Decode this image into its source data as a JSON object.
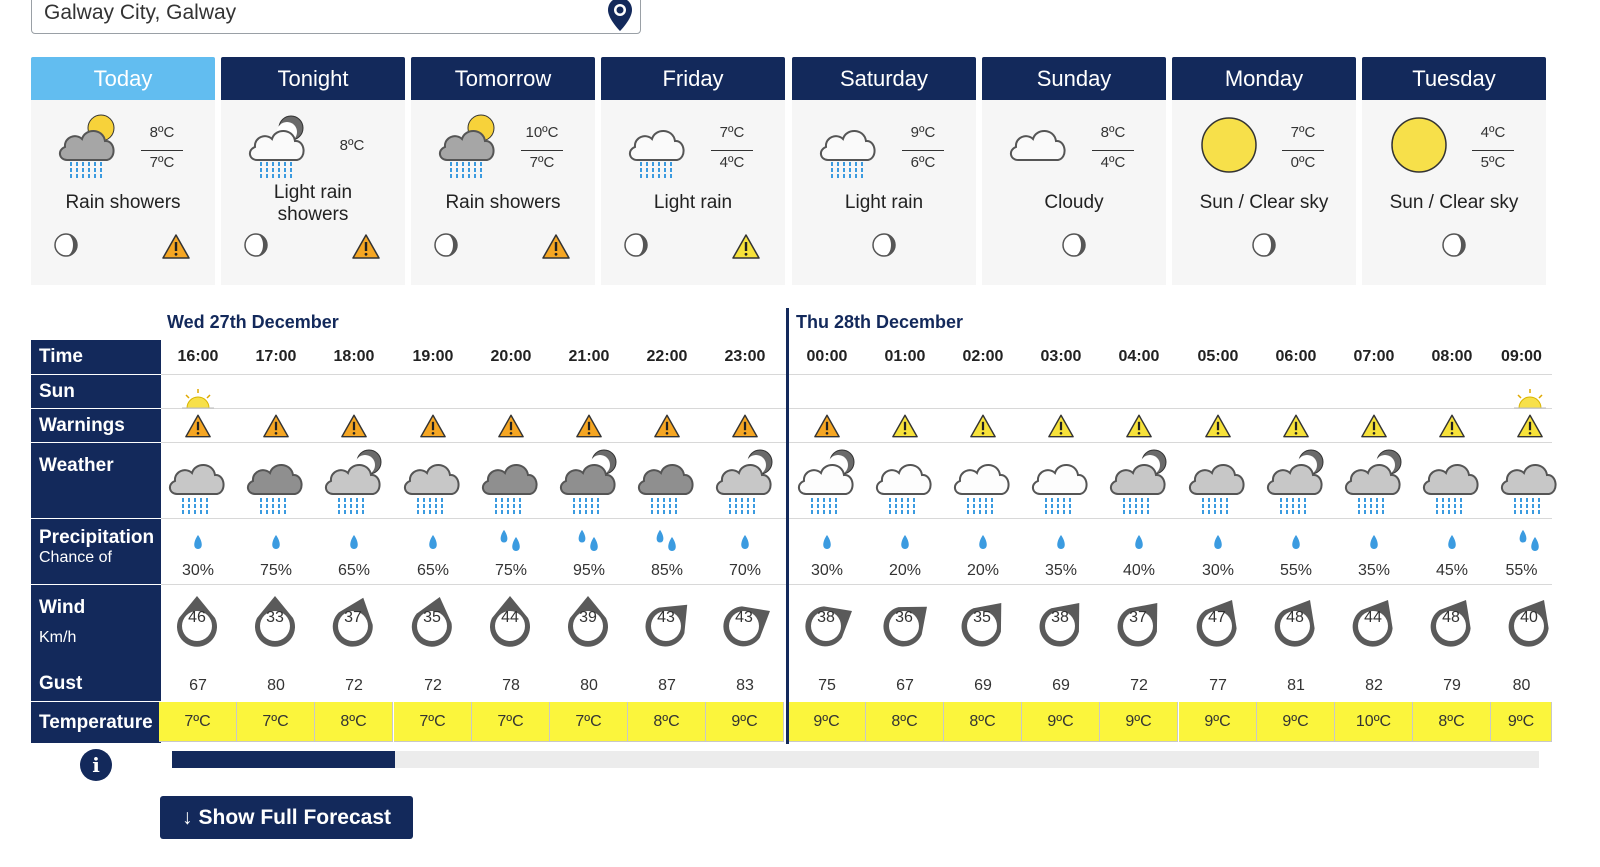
{
  "location": {
    "value": "Galway City, Galway",
    "pin_icon": "location-pin-icon"
  },
  "days": [
    {
      "label": "Today",
      "active": true,
      "hi": "8ºC",
      "lo": "7ºC",
      "desc": "Rain showers",
      "icon": "cloud-sun-rain",
      "warn": "orange"
    },
    {
      "label": "Tonight",
      "active": false,
      "single": "8ºC",
      "desc": "Light rain showers",
      "icon": "cloud-moon-rain",
      "warn": "orange"
    },
    {
      "label": "Tomorrow",
      "active": false,
      "hi": "10ºC",
      "lo": "7ºC",
      "desc": "Rain showers",
      "icon": "cloud-sun-rain",
      "warn": "orange"
    },
    {
      "label": "Friday",
      "active": false,
      "hi": "7ºC",
      "lo": "4ºC",
      "desc": "Light rain",
      "icon": "cloud-rain",
      "warn": "yellow"
    },
    {
      "label": "Saturday",
      "active": false,
      "hi": "9ºC",
      "lo": "6ºC",
      "desc": "Light rain",
      "icon": "cloud-rain",
      "warn": ""
    },
    {
      "label": "Sunday",
      "active": false,
      "hi": "8ºC",
      "lo": "4ºC",
      "desc": "Cloudy",
      "icon": "cloud",
      "warn": ""
    },
    {
      "label": "Monday",
      "active": false,
      "hi": "7ºC",
      "lo": "0ºC",
      "desc": "Sun / Clear sky",
      "icon": "sun",
      "warn": ""
    },
    {
      "label": "Tuesday",
      "active": false,
      "hi": "4ºC",
      "lo": "5ºC",
      "desc": "Sun / Clear sky",
      "icon": "sun",
      "warn": ""
    }
  ],
  "dates": {
    "day1": "Wed 27th December",
    "day2": "Thu 28th December"
  },
  "row_labels": {
    "time": "Time",
    "sun": "Sun",
    "warnings": "Warnings",
    "weather": "Weather",
    "precip": "Precipitation",
    "precip_sub": "Chance of",
    "wind": "Wind",
    "wind_sub": "Km/h",
    "gust": "Gust",
    "temperature": "Temperature"
  },
  "hours": [
    {
      "time": "16:00",
      "sun": true,
      "warn": "orange",
      "wx": "light",
      "drops": 1,
      "pct": "30%",
      "wind": "46",
      "dir": 0,
      "gust": "67",
      "temp": "7ºC"
    },
    {
      "time": "17:00",
      "sun": false,
      "warn": "orange",
      "wx": "dark",
      "drops": 1,
      "pct": "75%",
      "wind": "33",
      "dir": 0,
      "gust": "80",
      "temp": "7ºC"
    },
    {
      "time": "18:00",
      "sun": false,
      "warn": "orange",
      "wx": "moon-light",
      "drops": 1,
      "pct": "65%",
      "wind": "37",
      "dir": 20,
      "gust": "72",
      "temp": "8ºC"
    },
    {
      "time": "19:00",
      "sun": false,
      "warn": "orange",
      "wx": "light",
      "drops": 1,
      "pct": "65%",
      "wind": "35",
      "dir": 15,
      "gust": "72",
      "temp": "7ºC"
    },
    {
      "time": "20:00",
      "sun": false,
      "warn": "orange",
      "wx": "dark",
      "drops": 2,
      "pct": "75%",
      "wind": "44",
      "dir": 0,
      "gust": "78",
      "temp": "7ºC"
    },
    {
      "time": "21:00",
      "sun": false,
      "warn": "orange",
      "wx": "moon-dark",
      "drops": 2,
      "pct": "95%",
      "wind": "39",
      "dir": 0,
      "gust": "80",
      "temp": "7ºC"
    },
    {
      "time": "22:00",
      "sun": false,
      "warn": "orange",
      "wx": "dark",
      "drops": 2,
      "pct": "85%",
      "wind": "43",
      "dir": 45,
      "gust": "87",
      "temp": "8ºC"
    },
    {
      "time": "23:00",
      "sun": false,
      "warn": "orange",
      "wx": "moon-light",
      "drops": 1,
      "pct": "70%",
      "wind": "43",
      "dir": 60,
      "gust": "83",
      "temp": "9ºC"
    },
    {
      "time": "00:00",
      "sun": false,
      "warn": "orange",
      "wx": "moon-white",
      "drops": 1,
      "pct": "30%",
      "wind": "38",
      "dir": 60,
      "gust": "75",
      "temp": "9ºC"
    },
    {
      "time": "01:00",
      "sun": false,
      "warn": "yellow",
      "wx": "white",
      "drops": 1,
      "pct": "20%",
      "wind": "36",
      "dir": 50,
      "gust": "67",
      "temp": "8ºC"
    },
    {
      "time": "02:00",
      "sun": false,
      "warn": "yellow",
      "wx": "white",
      "drops": 1,
      "pct": "20%",
      "wind": "35",
      "dir": 40,
      "gust": "69",
      "temp": "8ºC"
    },
    {
      "time": "03:00",
      "sun": false,
      "warn": "yellow",
      "wx": "white",
      "drops": 1,
      "pct": "35%",
      "wind": "38",
      "dir": 40,
      "gust": "69",
      "temp": "9ºC"
    },
    {
      "time": "04:00",
      "sun": false,
      "warn": "yellow",
      "wx": "moon-light",
      "drops": 1,
      "pct": "40%",
      "wind": "37",
      "dir": 40,
      "gust": "72",
      "temp": "9ºC"
    },
    {
      "time": "05:00",
      "sun": false,
      "warn": "yellow",
      "wx": "light",
      "drops": 1,
      "pct": "30%",
      "wind": "47",
      "dir": 30,
      "gust": "77",
      "temp": "9ºC"
    },
    {
      "time": "06:00",
      "sun": false,
      "warn": "yellow",
      "wx": "moon-light",
      "drops": 1,
      "pct": "55%",
      "wind": "48",
      "dir": 30,
      "gust": "81",
      "temp": "9ºC"
    },
    {
      "time": "07:00",
      "sun": false,
      "warn": "yellow",
      "wx": "moon-light",
      "drops": 1,
      "pct": "35%",
      "wind": "44",
      "dir": 30,
      "gust": "82",
      "temp": "10ºC"
    },
    {
      "time": "08:00",
      "sun": false,
      "warn": "yellow",
      "wx": "light",
      "drops": 1,
      "pct": "45%",
      "wind": "48",
      "dir": 30,
      "gust": "79",
      "temp": "8ºC"
    },
    {
      "time": "09:00",
      "sun": true,
      "warn": "yellow",
      "wx": "light",
      "drops": 2,
      "pct": "55%",
      "wind": "40",
      "dir": 30,
      "gust": "80",
      "temp": "9ºC"
    }
  ],
  "scroll": {
    "position": 0.16
  },
  "buttons": {
    "full_forecast": "Show Full Forecast",
    "info": "i"
  },
  "colors": {
    "navy": "#13295b",
    "active_tab": "#62bdf0",
    "temp_bg": "#fbf53c",
    "warn_orange": "#f5a623",
    "warn_yellow": "#f7e23a",
    "rain": "#3b9be0"
  }
}
